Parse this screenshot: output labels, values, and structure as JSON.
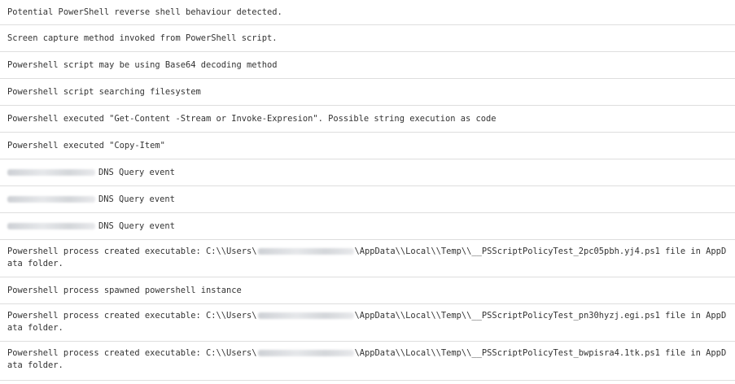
{
  "alerts": [
    {
      "text": "Potential PowerShell reverse shell behaviour detected."
    },
    {
      "text": "Screen capture method invoked from PowerShell script."
    },
    {
      "text": "Powershell script may be using Base64 decoding method"
    },
    {
      "text": "Powershell script searching filesystem"
    },
    {
      "text": "Powershell executed \"Get-Content -Stream or Invoke-Expresion\". Possible string execution as code"
    },
    {
      "text": "Powershell executed \"Copy-Item\""
    },
    {
      "text": "DNS Query event"
    },
    {
      "text": "DNS Query event"
    },
    {
      "text": "DNS Query event"
    },
    {
      "path_prefix": "Powershell process created executable: C:\\\\Users\\",
      "path_suffix": "\\AppData\\\\Local\\\\Temp\\\\__PSScriptPolicyTest_2pc05pbh.yj4.ps1 file in AppData folder."
    },
    {
      "text": "Powershell process spawned powershell instance"
    },
    {
      "path_prefix": "Powershell process created executable: C:\\\\Users\\",
      "path_suffix": "\\AppData\\\\Local\\\\Temp\\\\__PSScriptPolicyTest_pn30hyzj.egi.ps1 file in AppData folder."
    },
    {
      "path_prefix": "Powershell process created executable: C:\\\\Users\\",
      "path_suffix": "\\AppData\\\\Local\\\\Temp\\\\__PSScriptPolicyTest_bwpisra4.1tk.ps1 file in AppData folder."
    }
  ]
}
